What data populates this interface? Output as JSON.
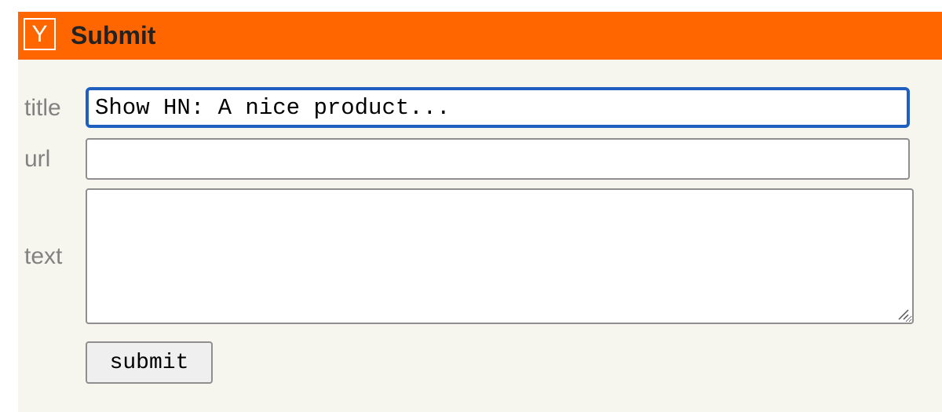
{
  "header": {
    "logo_letter": "Y",
    "title": "Submit",
    "background_color": "#ff6600"
  },
  "form": {
    "title_label": "title",
    "title_value": "Show HN: A nice product...",
    "url_label": "url",
    "url_value": "",
    "text_label": "text",
    "text_value": "",
    "submit_label": "submit"
  },
  "colors": {
    "page_background": "#f6f6ef",
    "label_color": "#828282",
    "focus_border": "#1f5fbf"
  }
}
